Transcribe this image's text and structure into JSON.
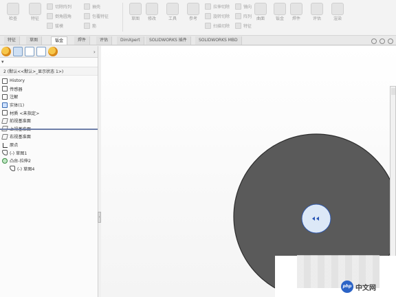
{
  "ribbon": {
    "big_buttons": [
      {
        "label": "检查"
      },
      {
        "label": "特征"
      },
      {
        "label": "草图"
      },
      {
        "label": "修改"
      },
      {
        "label": "工具"
      },
      {
        "label": "参考"
      },
      {
        "label": "曲面"
      },
      {
        "label": "钣金"
      },
      {
        "label": "焊件"
      },
      {
        "label": "评估"
      },
      {
        "label": "渲染"
      }
    ],
    "small_col1": [
      "切除阵列",
      "倒角圆角",
      "拔模"
    ],
    "small_col2": [
      "抽壳",
      "包覆特征",
      "筋"
    ],
    "small_col3": [
      "拉伸切除",
      "旋转切除",
      "扫描切除"
    ],
    "small_col4": [
      "镜向",
      "阵列",
      "特征"
    ]
  },
  "tabs": [
    {
      "label": "特征"
    },
    {
      "label": "草图"
    },
    {
      "label": "钣金"
    },
    {
      "label": "焊件"
    },
    {
      "label": "评估"
    },
    {
      "label": "DimXpert"
    },
    {
      "label": "SOLIDWORKS 插件"
    },
    {
      "label": "SOLIDWORKS MBD"
    }
  ],
  "panel": {
    "root": "2 (默认<<默认>_显示状态 1>)",
    "tree": [
      {
        "label": "History",
        "icon": "history-icon"
      },
      {
        "label": "传感器",
        "icon": "sensor-icon"
      },
      {
        "label": "注解",
        "icon": "annotation-icon"
      },
      {
        "label": "实体(1)",
        "icon": "solid-body-icon"
      },
      {
        "label": "材质 <未指定>",
        "icon": "material-icon"
      },
      {
        "label": "前视基准面",
        "icon": "plane-icon"
      },
      {
        "label": "上视基准面",
        "icon": "plane-icon"
      },
      {
        "label": "右视基准面",
        "icon": "plane-icon"
      },
      {
        "label": "原点",
        "icon": "origin-icon"
      },
      {
        "label": "(-) 草图1",
        "icon": "sketch-icon"
      },
      {
        "label": "凸台-拉伸2",
        "icon": "boss-extrude-icon"
      },
      {
        "label": "(-) 草图4",
        "icon": "sketch-icon"
      }
    ]
  },
  "watermark": {
    "site": "中文网",
    "logo": "php"
  },
  "colors": {
    "part_fill": "#5a5a5a",
    "part_edge": "#2c2c2c",
    "hole_fill": "#dce8f7",
    "hole_edge": "#2e56a8"
  }
}
